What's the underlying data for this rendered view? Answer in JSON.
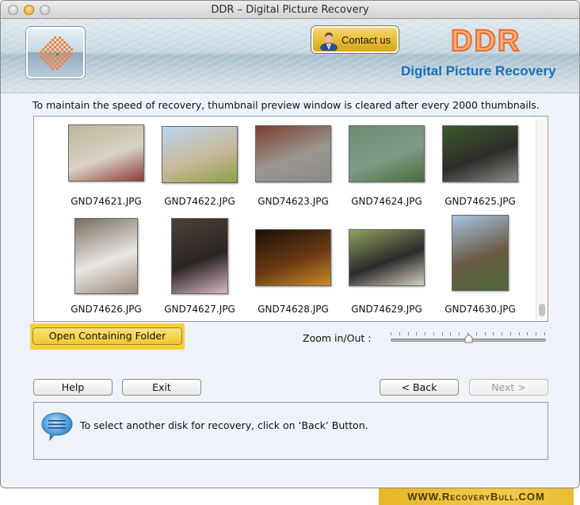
{
  "window": {
    "title": "DDR – Digital Picture Recovery"
  },
  "header": {
    "logo_icon": "checker-diamond-logo-icon",
    "contact_label": "Contact us",
    "contact_icon": "person-icon",
    "brand": "DDR",
    "subtitle": "Digital Picture Recovery"
  },
  "info_text": "To maintain the speed of recovery, thumbnail preview window is cleared after every 2000 thumbnails.",
  "thumbnails": [
    {
      "name": "GND74621.JPG",
      "colors": [
        "#b9b59a",
        "#d9d4c4",
        "#8e3a3a"
      ]
    },
    {
      "name": "GND74622.JPG",
      "colors": [
        "#bcd8ef",
        "#c7b89a",
        "#8fa046"
      ]
    },
    {
      "name": "GND74623.JPG",
      "colors": [
        "#7a3f2e",
        "#9b9690",
        "#8b8a88"
      ]
    },
    {
      "name": "GND74624.JPG",
      "colors": [
        "#6f8a74",
        "#7c9b87",
        "#4f6b3a"
      ]
    },
    {
      "name": "GND74625.JPG",
      "colors": [
        "#3b5a2c",
        "#2c2c2a",
        "#8a8a86"
      ]
    },
    {
      "name": "GND74626.JPG",
      "colors": [
        "#7a6d60",
        "#e9e6e2",
        "#9c8a7a"
      ]
    },
    {
      "name": "GND74627.JPG",
      "colors": [
        "#4d4038",
        "#2a2522",
        "#d8b7c8"
      ]
    },
    {
      "name": "GND74628.JPG",
      "colors": [
        "#1a1108",
        "#6a3a12",
        "#c88a2a"
      ]
    },
    {
      "name": "GND74629.JPG",
      "colors": [
        "#8fa35f",
        "#2a2a2a",
        "#d8d0c0"
      ]
    },
    {
      "name": "GND74630.JPG",
      "colors": [
        "#a7c4e3",
        "#6a5a44",
        "#4f6a38"
      ]
    }
  ],
  "open_folder_label": "Open Containing Folder",
  "zoom": {
    "label": "Zoom in/Out :",
    "value_fraction": 0.5,
    "tick_count": 19
  },
  "buttons": {
    "help": "Help",
    "exit": "Exit",
    "back": "< Back",
    "next": "Next >"
  },
  "status": {
    "icon": "speech-bubble-icon",
    "message": "To select another disk for recovery, click on ‘Back’ Button."
  },
  "watermark": "WWW.RecoveryBull.COM"
}
